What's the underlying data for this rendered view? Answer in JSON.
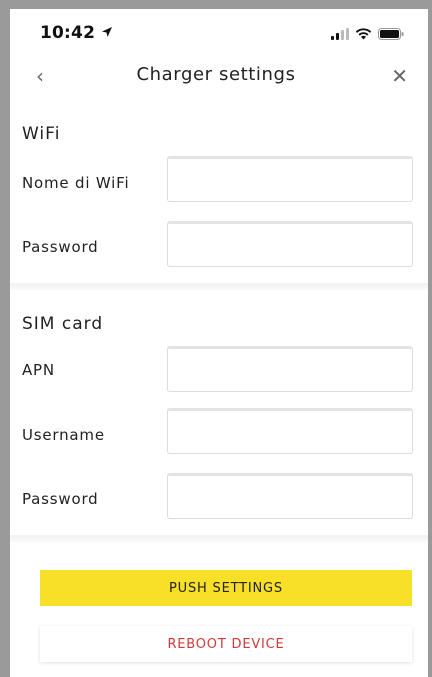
{
  "status_bar": {
    "time": "10:42",
    "icons": [
      "location-arrow-icon",
      "signal-icon",
      "wifi-icon",
      "battery-icon"
    ]
  },
  "nav": {
    "title": "Charger settings",
    "back_icon": "‹",
    "close_icon": "✕"
  },
  "wifi": {
    "section_title": "WiFi",
    "name_label": "Nome di WiFi",
    "name_value": "",
    "password_label": "Password",
    "password_value": ""
  },
  "sim": {
    "section_title": "SIM card",
    "apn_label": "APN",
    "apn_value": "",
    "username_label": "Username",
    "username_value": "",
    "password_label": "Password",
    "password_value": ""
  },
  "actions": {
    "push_label": "PUSH SETTINGS",
    "reboot_label": "REBOOT DEVICE"
  },
  "colors": {
    "accent_yellow": "#f8df28",
    "danger_red": "#d23a3a"
  }
}
